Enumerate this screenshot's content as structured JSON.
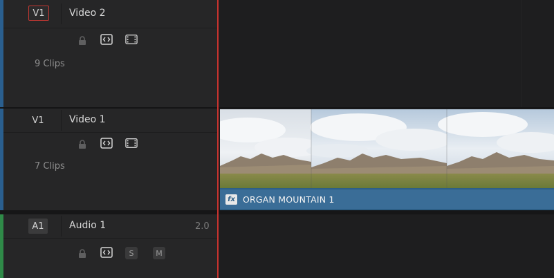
{
  "colors": {
    "video_track_bar": "#2a5f8f",
    "audio_track_bar": "#2f8a48",
    "playhead": "#c8332f",
    "clip_fill": "#3a6d97",
    "selected_outline": "#c43833"
  },
  "tracks": {
    "video2": {
      "id": "V1",
      "name": "Video 2",
      "clips": "9 Clips",
      "selected": true
    },
    "video1": {
      "id": "V1",
      "name": "Video 1",
      "clips": "7 Clips"
    },
    "audio1": {
      "id": "A1",
      "name": "Audio 1",
      "channels": "2.0",
      "solo_label": "S",
      "mute_label": "M"
    }
  },
  "icons": {
    "lock": "lock-icon",
    "auto_select": "auto-select-icon",
    "video_toggle": "film-strip-icon"
  },
  "clip": {
    "name": "ORGAN MOUNTAIN 1",
    "fx_badge": "fx"
  }
}
